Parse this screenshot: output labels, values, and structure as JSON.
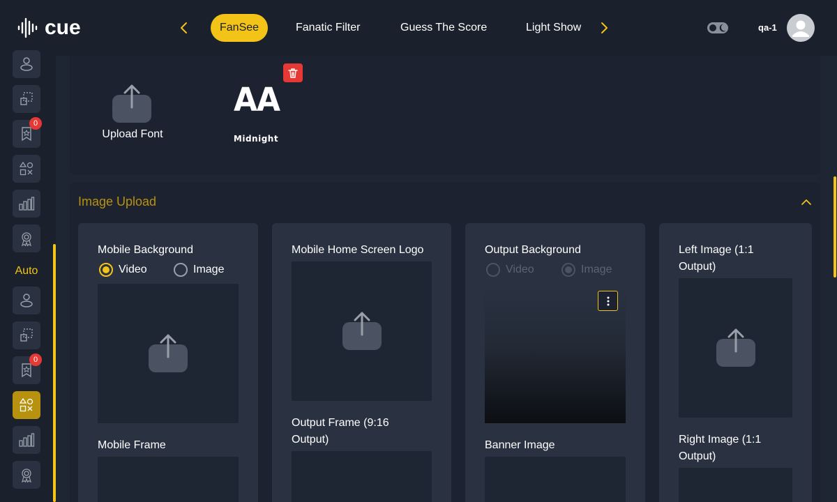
{
  "header": {
    "logo_text": "cue",
    "tabs": [
      {
        "label": "FanSee",
        "active": true
      },
      {
        "label": "Fanatic Filter",
        "active": false
      },
      {
        "label": "Guess The Score",
        "active": false
      },
      {
        "label": "Light Show",
        "active": false
      }
    ],
    "user_name": "qa-1",
    "accent_color": "#f4c318"
  },
  "sidebar": {
    "section_label": "Auto",
    "badges": [
      "0",
      "0"
    ],
    "top_group_icons": [
      "user-icon",
      "layout-icon",
      "rating-icon",
      "shapes-icon",
      "bar-chart-icon",
      "award-icon"
    ],
    "auto_group_icons": [
      "user-icon",
      "layout-icon",
      "rating-icon",
      "shapes-icon",
      "bar-chart-icon",
      "award-icon"
    ]
  },
  "fonts": {
    "upload_label": "Upload Font",
    "preview_glyphs": "AA",
    "font_name": "Midnight"
  },
  "image_upload": {
    "title": "Image Upload",
    "cards": [
      {
        "label": "Mobile Background",
        "radio_video": "Video",
        "radio_image": "Image",
        "selected": "Video",
        "second_label": "Mobile Frame"
      },
      {
        "label": "Mobile Home Screen Logo",
        "second_label": "Output Frame (9:16 Output)"
      },
      {
        "label": "Output Background",
        "radio_video": "Video",
        "radio_image": "Image",
        "selected": "Image",
        "disabled": true,
        "second_label": "Banner Image"
      },
      {
        "label": "Left Image (1:1 Output)",
        "second_label": "Right Image (1:1 Output)"
      }
    ]
  }
}
